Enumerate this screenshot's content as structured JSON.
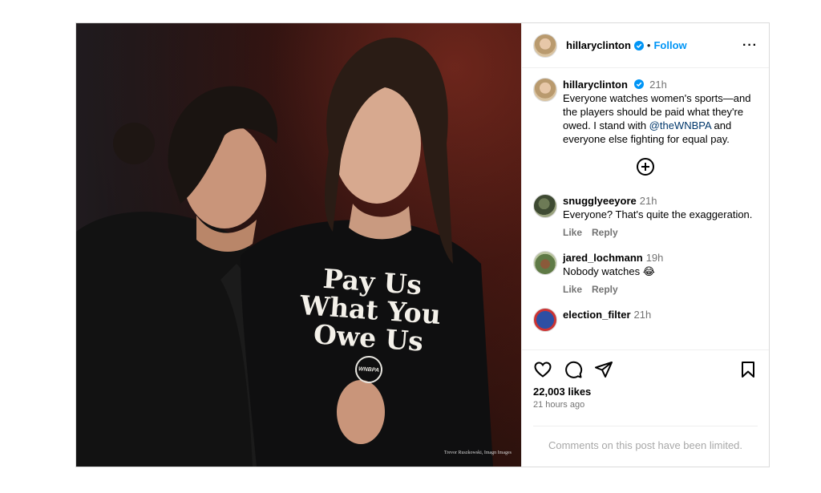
{
  "post": {
    "username": "hillaryclinton",
    "follow_label": "Follow",
    "dot": "•",
    "more_label": "···",
    "photo_credit": "Trevor Ruszkowski, Imagn Images",
    "shirt_text": [
      "Pay Us",
      "What You",
      "Owe Us"
    ],
    "shirt_logo": "WNBPA"
  },
  "caption": {
    "username": "hillaryclinton",
    "time": "21h",
    "text_part1": "Everyone watches women's sports—and the players should be paid what they're owed. I stand with ",
    "mention": "@theWNBPA",
    "text_part2": " and everyone else fighting for equal pay."
  },
  "comments": [
    {
      "username": "snugglyeeyore",
      "time": "21h",
      "text": "Everyone? That's quite the exaggeration.",
      "like": "Like",
      "reply": "Reply"
    },
    {
      "username": "jared_lochmann",
      "time": "19h",
      "text": "Nobody watches 😂",
      "like": "Like",
      "reply": "Reply"
    },
    {
      "username": "election_filter",
      "time": "21h",
      "text": ""
    }
  ],
  "footer": {
    "likes": "22,003 likes",
    "time_ago": "21 hours ago",
    "limited": "Comments on this post have been limited."
  },
  "icons": [
    "heart-icon",
    "comment-icon",
    "share-icon",
    "bookmark-icon",
    "add-circle-icon",
    "verified-icon"
  ],
  "colors": {
    "link_blue": "#0095f6",
    "verified": "#0095f6",
    "mention": "#00376b",
    "muted": "#737373"
  }
}
